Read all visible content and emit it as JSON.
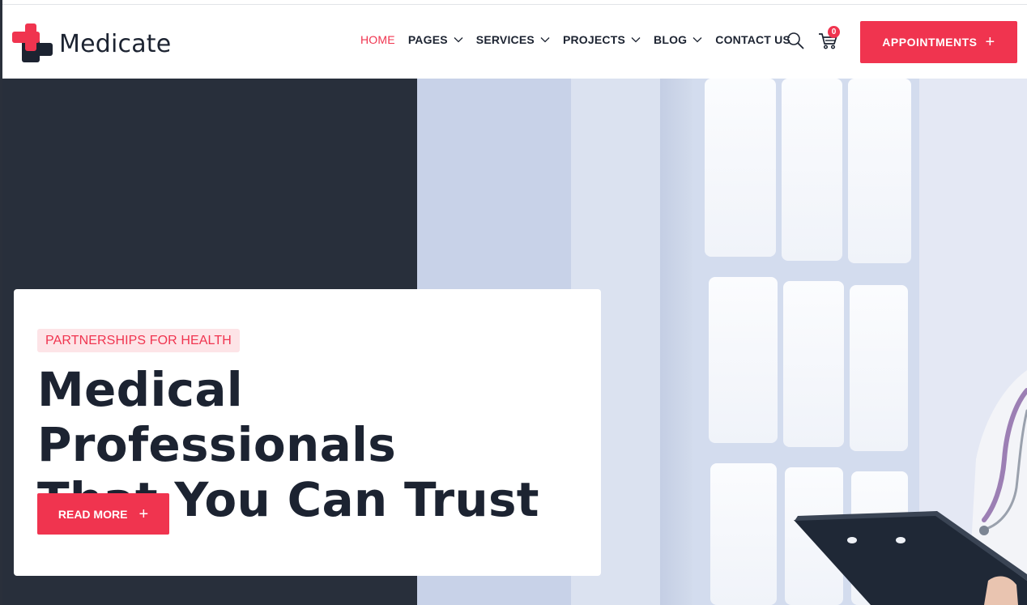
{
  "brand": {
    "name": "Medicate",
    "accent": "#f0344f",
    "dark": "#282f3b"
  },
  "nav": {
    "items": [
      {
        "label": "HOME",
        "active": true,
        "has_dropdown": false
      },
      {
        "label": "PAGES",
        "active": false,
        "has_dropdown": true
      },
      {
        "label": "SERVICES",
        "active": false,
        "has_dropdown": true
      },
      {
        "label": "PROJECTS",
        "active": false,
        "has_dropdown": true
      },
      {
        "label": "BLOG",
        "active": false,
        "has_dropdown": true
      },
      {
        "label": "CONTACT US",
        "active": false,
        "has_dropdown": false
      }
    ],
    "search_icon": "search-icon",
    "cart_icon": "shopping-cart-icon",
    "cart_count": "0",
    "appointments_label": "APPOINTMENTS",
    "appointments_icon": "plus-icon"
  },
  "hero": {
    "tagline": "PARTNERSHIPS FOR HEALTH",
    "headline_line1": "Medical Professionals",
    "headline_line2": "That You Can Trust",
    "cta_label": "READ MORE",
    "cta_icon": "plus-icon",
    "image": "doctor-with-clipboard-photo"
  }
}
